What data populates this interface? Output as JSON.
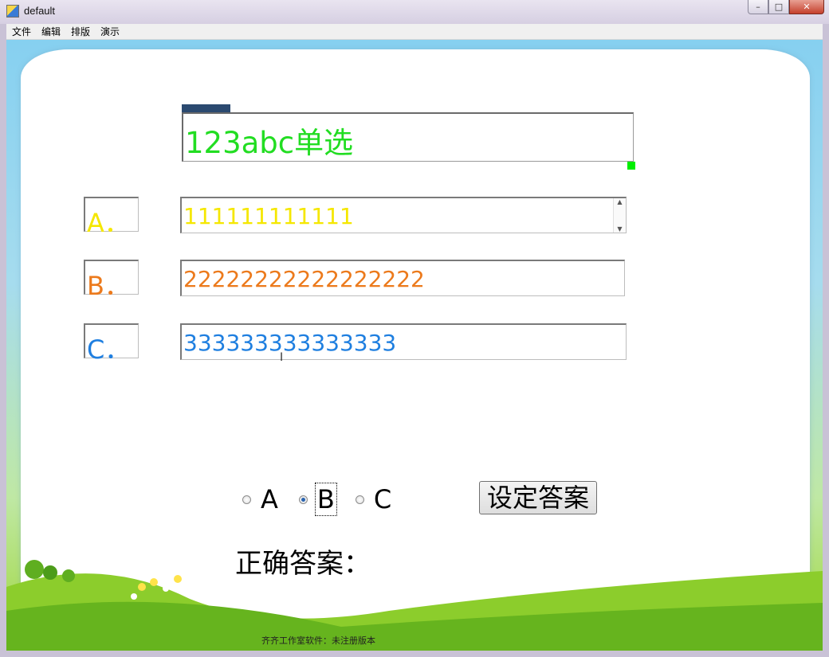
{
  "window": {
    "title": "default",
    "close_glyph": "✕",
    "min_glyph": "–",
    "max_glyph": "□"
  },
  "menu": [
    "文件",
    "编辑",
    "排版",
    "演示"
  ],
  "question": {
    "text": "123abc单选",
    "color": "#22dd22"
  },
  "options": [
    {
      "label": "A．",
      "text": "111111111111",
      "color": "#f5e700"
    },
    {
      "label": "B．",
      "text": "22222222222222222",
      "color": "#ec7a1c"
    },
    {
      "label": "C．",
      "text": "333333333333333",
      "color": "#1f7fe0"
    }
  ],
  "radios": [
    {
      "label": "A",
      "checked": false
    },
    {
      "label": "B",
      "checked": true
    },
    {
      "label": "C",
      "checked": false
    }
  ],
  "set_answer_button": "设定答案",
  "correct_answer_label": "正确答案：",
  "footer": "齐齐工作室软件：未注册版本"
}
